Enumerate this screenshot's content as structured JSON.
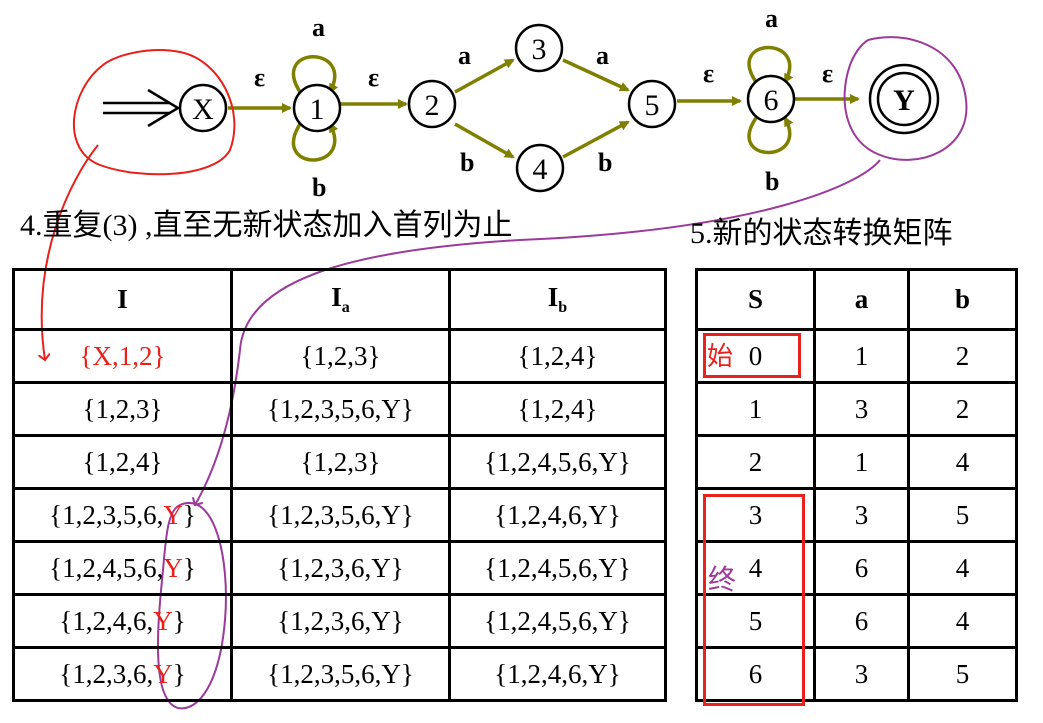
{
  "diagram": {
    "states": [
      "X",
      "1",
      "2",
      "3",
      "4",
      "5",
      "6",
      "Y"
    ],
    "accept_state": "Y",
    "start_marker": "arrow-to-X",
    "edges": [
      {
        "from": "X",
        "to": "1",
        "label": "ε"
      },
      {
        "from": "1",
        "to": "1",
        "label": "a"
      },
      {
        "from": "1",
        "to": "1",
        "label": "b"
      },
      {
        "from": "1",
        "to": "2",
        "label": "ε"
      },
      {
        "from": "2",
        "to": "3",
        "label": "a"
      },
      {
        "from": "2",
        "to": "4",
        "label": "b"
      },
      {
        "from": "3",
        "to": "5",
        "label": "a"
      },
      {
        "from": "4",
        "to": "5",
        "label": "b"
      },
      {
        "from": "5",
        "to": "6",
        "label": "ε"
      },
      {
        "from": "6",
        "to": "6",
        "label": "a"
      },
      {
        "from": "6",
        "to": "6",
        "label": "b"
      },
      {
        "from": "6",
        "to": "Y",
        "label": "ε"
      }
    ],
    "edge_color": "#7f7f00"
  },
  "captions": {
    "step4": "4.重复(3) ,直至无新状态加入首列为止",
    "step5": "5.新的状态转换矩阵"
  },
  "subset_table": {
    "headers": {
      "i": "I",
      "ia_base": "I",
      "ia_sub": "a",
      "ib_base": "I",
      "ib_sub": "b"
    },
    "rows": [
      {
        "i": [
          "{X,1,2}",
          ""
        ],
        "ia": "{1,2,3}",
        "ib": "{1,2,4}",
        "i_red": true
      },
      {
        "i": [
          "{1,2,3}",
          ""
        ],
        "ia": "{1,2,3,5,6,Y}",
        "ib": "{1,2,4}"
      },
      {
        "i": [
          "{1,2,4}",
          ""
        ],
        "ia": "{1,2,3}",
        "ib": "{1,2,4,5,6,Y}"
      },
      {
        "i": [
          "{1,2,3,5,6,",
          "Y",
          "}"
        ],
        "ia": "{1,2,3,5,6,Y}",
        "ib": "{1,2,4,6,Y}"
      },
      {
        "i": [
          "{1,2,4,5,6,",
          "Y",
          "}"
        ],
        "ia": "{1,2,3,6,Y}",
        "ib": "{1,2,4,5,6,Y}"
      },
      {
        "i": [
          "{1,2,4,6,",
          "Y",
          "}"
        ],
        "ia": "{1,2,3,6,Y}",
        "ib": "{1,2,4,5,6,Y}"
      },
      {
        "i": [
          "{1,2,3,6,",
          "Y",
          "}"
        ],
        "ia": "{1,2,3,5,6,Y}",
        "ib": "{1,2,4,6,Y}"
      }
    ]
  },
  "matrix_table": {
    "headers": {
      "s": "S",
      "a": "a",
      "b": "b"
    },
    "rows": [
      {
        "s": "0",
        "a": "1",
        "b": "2"
      },
      {
        "s": "1",
        "a": "3",
        "b": "2"
      },
      {
        "s": "2",
        "a": "1",
        "b": "4"
      },
      {
        "s": "3",
        "a": "3",
        "b": "5"
      },
      {
        "s": "4",
        "a": "6",
        "b": "4"
      },
      {
        "s": "5",
        "a": "6",
        "b": "4"
      },
      {
        "s": "6",
        "a": "3",
        "b": "5"
      }
    ]
  },
  "annotations": {
    "start_note": "始",
    "final_note": "终",
    "red": "#e8211b",
    "purple": "#9b3a9a"
  }
}
